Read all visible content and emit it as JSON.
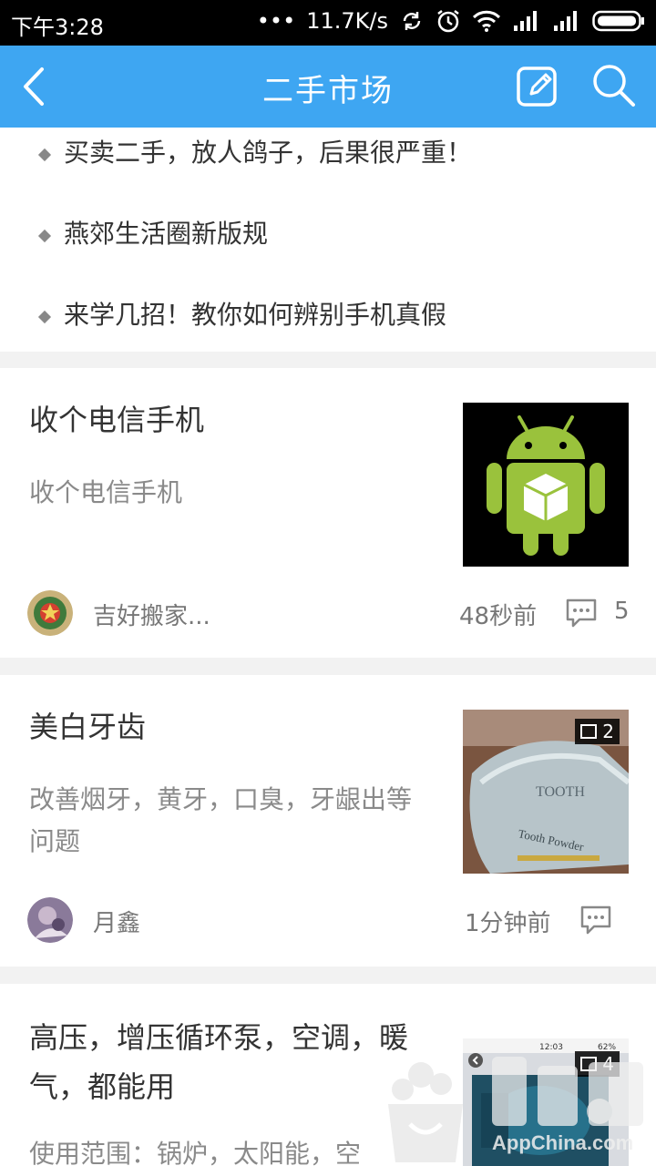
{
  "status_bar": {
    "time": "下午3:28",
    "dots": "•••",
    "speed": "11.7K/s",
    "icons": [
      "sync-icon",
      "alarm-icon",
      "wifi-icon",
      "signal-icon",
      "signal-icon",
      "battery-icon"
    ]
  },
  "app_bar": {
    "title": "二手市场",
    "background": "#3ea6f2",
    "icons": [
      "back-arrow-icon",
      "edit-icon",
      "search-icon"
    ]
  },
  "notices": [
    "买卖二手，放人鸽子，后果很严重！",
    "燕郊生活圈新版规",
    "来学几招！教你如何辨别手机真假"
  ],
  "posts": [
    {
      "title": "收个电信手机",
      "desc": "收个电信手机",
      "author": "吉好搬家...",
      "time": "48秒前",
      "comments": "5",
      "image_count": ""
    },
    {
      "title": "美白牙齿",
      "desc": "改善烟牙，黄牙，口臭，牙龈出等问题",
      "author": "月鑫",
      "time": "1分钟前",
      "comments": "",
      "image_count": "2"
    },
    {
      "title": "高压，增压循环泵，空调，暖气，都能用",
      "desc": "使用范围：锅炉，太阳能，空",
      "author": "",
      "time": "",
      "comments": "",
      "image_count": "4"
    }
  ],
  "thumb_text": {
    "box_brand": "TOOTH",
    "box_label": "Tooth Powder",
    "phone_time": "12:03",
    "phone_battery": "62%"
  },
  "watermark": {
    "site": "AppChina.com"
  }
}
